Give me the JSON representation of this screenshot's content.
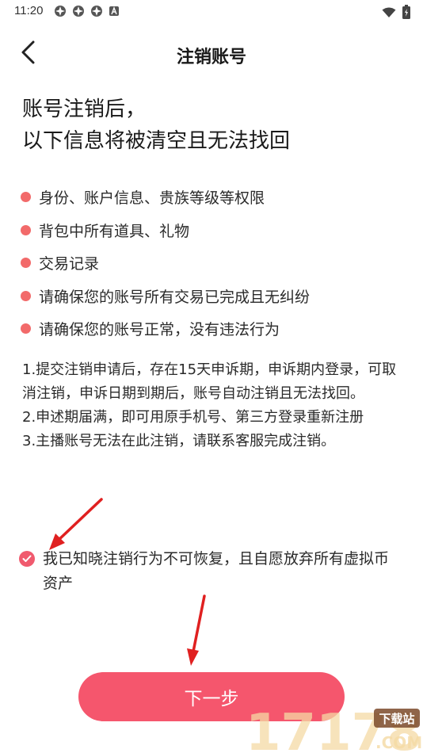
{
  "status_bar": {
    "time": "11:20",
    "left_icons": [
      "app-notification-icon",
      "app-notification-icon",
      "app-notification-icon",
      "a-badge-icon"
    ],
    "right_icons": [
      "wifi-icon",
      "battery-icon"
    ]
  },
  "nav": {
    "title": "注销账号",
    "back_icon": "chevron-left-icon"
  },
  "headline": {
    "line1": "账号注销后，",
    "line2": "以下信息将被清空且无法找回"
  },
  "bullets": [
    "身份、账户信息、贵族等级等权限",
    "背包中所有道具、礼物",
    "交易记录",
    "请确保您的账号所有交易已完成且无纠纷",
    "请确保您的账号正常，没有违法行为"
  ],
  "notes": [
    "1.提交注销申请后，存在15天申诉期，申诉期内登录，可取消注销，申诉日期到期后，账号自动注销且无法找回。",
    "2.申述期届满，即可用原手机号、第三方登录重新注册",
    "3.主播账号无法在此注销，请联系客服完成注销。"
  ],
  "agreement": {
    "checked": true,
    "text": "我已知晓注销行为不可恢复，且自愿放弃所有虚拟币资产"
  },
  "next_button": {
    "label": "下一步"
  },
  "watermark": {
    "brand": "17178",
    "sub": ".COM",
    "tag": "下载站"
  },
  "colors": {
    "accent": "#f5566d",
    "bullet": "#f26a6a",
    "arrow": "#e02020"
  }
}
